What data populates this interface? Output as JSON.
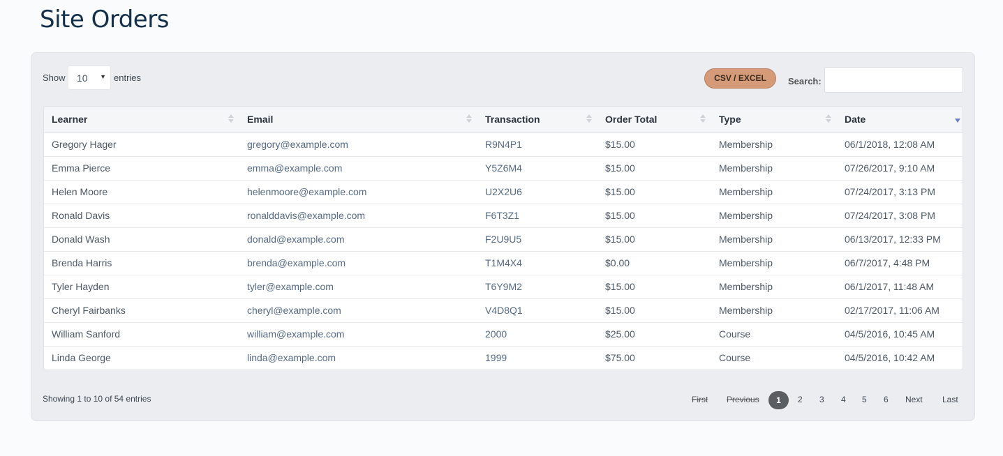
{
  "page": {
    "title": "Site Orders"
  },
  "controls": {
    "show_label": "Show",
    "length_value": "10",
    "entries_label": "entries",
    "export_label": "CSV / EXCEL",
    "search_label": "Search:",
    "search_value": ""
  },
  "table": {
    "columns": [
      "Learner",
      "Email",
      "Transaction",
      "Order Total",
      "Type",
      "Date"
    ],
    "sorted_column": "Date",
    "sort_direction": "descending",
    "rows": [
      [
        "Gregory Hager",
        "gregory@example.com",
        "R9N4P1",
        "$15.00",
        "Membership",
        "06/1/2018, 12:08 AM"
      ],
      [
        "Emma Pierce",
        "emma@example.com",
        "Y5Z6M4",
        "$15.00",
        "Membership",
        "07/26/2017, 9:10 AM"
      ],
      [
        "Helen Moore",
        "helenmoore@example.com",
        "U2X2U6",
        "$15.00",
        "Membership",
        "07/24/2017, 3:13 PM"
      ],
      [
        "Ronald Davis",
        "ronalddavis@example.com",
        "F6T3Z1",
        "$15.00",
        "Membership",
        "07/24/2017, 3:08 PM"
      ],
      [
        "Donald Wash",
        "donald@example.com",
        "F2U9U5",
        "$15.00",
        "Membership",
        "06/13/2017, 12:33 PM"
      ],
      [
        "Brenda Harris",
        "brenda@example.com",
        "T1M4X4",
        "$0.00",
        "Membership",
        "06/7/2017, 4:48 PM"
      ],
      [
        "Tyler Hayden",
        "tyler@example.com",
        "T6Y9M2",
        "$15.00",
        "Membership",
        "06/1/2017, 11:48 AM"
      ],
      [
        "Cheryl Fairbanks",
        "cheryl@example.com",
        "V4D8Q1",
        "$15.00",
        "Membership",
        "02/17/2017, 11:06 AM"
      ],
      [
        "William Sanford",
        "william@example.com",
        "2000",
        "$25.00",
        "Course",
        "04/5/2016, 10:45 AM"
      ],
      [
        "Linda George",
        "linda@example.com",
        "1999",
        "$75.00",
        "Course",
        "04/5/2016, 10:42 AM"
      ]
    ]
  },
  "footer": {
    "info": "Showing 1 to 10 of 54 entries",
    "pagination": {
      "first": "First",
      "previous": "Previous",
      "pages": [
        "1",
        "2",
        "3",
        "4",
        "5",
        "6"
      ],
      "current": "1",
      "next": "Next",
      "last": "Last"
    }
  },
  "colors": {
    "export_button": "#d59a78",
    "title": "#132f49",
    "current_page": "#5a5e63",
    "sort_active": "#6a7dc9"
  }
}
